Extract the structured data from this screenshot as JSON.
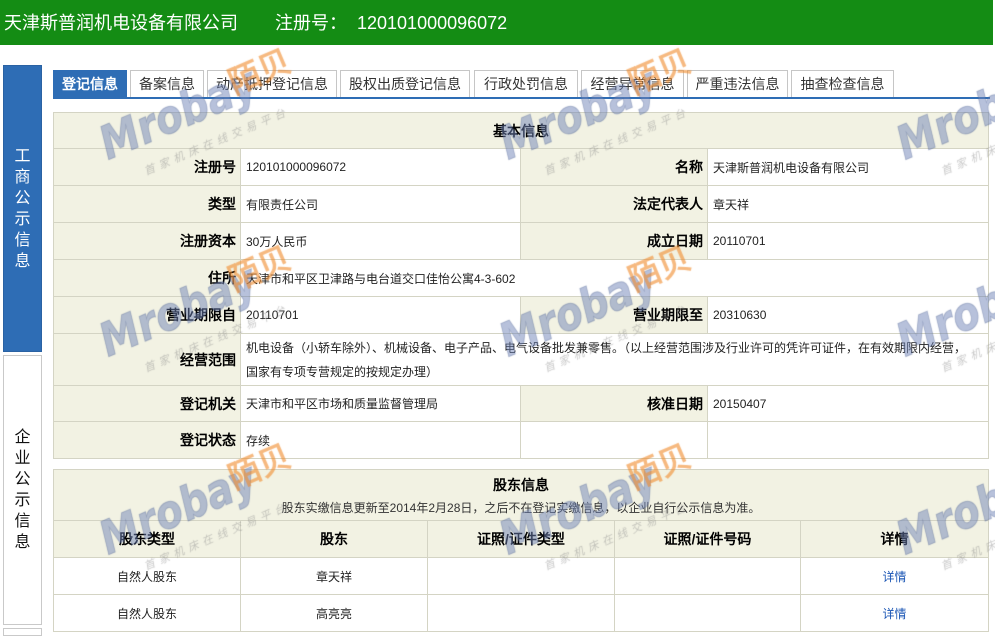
{
  "header": {
    "company_name": "天津斯普润机电设备有限公司",
    "reg_label": "注册号：",
    "reg_number": "120101000096072"
  },
  "sidebar": {
    "items": [
      {
        "label": "工商公示信息",
        "active": true
      },
      {
        "label": "企业公示信息",
        "active": false
      }
    ]
  },
  "tabs": [
    {
      "label": "登记信息",
      "active": true
    },
    {
      "label": "备案信息",
      "active": false
    },
    {
      "label": "动产抵押登记信息",
      "active": false
    },
    {
      "label": "股权出质登记信息",
      "active": false
    },
    {
      "label": "行政处罚信息",
      "active": false
    },
    {
      "label": "经营异常信息",
      "active": false
    },
    {
      "label": "严重违法信息",
      "active": false
    },
    {
      "label": "抽查检查信息",
      "active": false
    }
  ],
  "basic_info": {
    "title": "基本信息",
    "reg_no": {
      "label": "注册号",
      "value": "120101000096072"
    },
    "name": {
      "label": "名称",
      "value": "天津斯普润机电设备有限公司"
    },
    "type": {
      "label": "类型",
      "value": "有限责任公司"
    },
    "legal_rep": {
      "label": "法定代表人",
      "value": "章天祥"
    },
    "reg_capital": {
      "label": "注册资本",
      "value": "30万人民币"
    },
    "established": {
      "label": "成立日期",
      "value": "20110701"
    },
    "address": {
      "label": "住所",
      "value": "天津市和平区卫津路与电台道交口佳怡公寓4-3-602"
    },
    "term_from": {
      "label": "营业期限自",
      "value": "20110701"
    },
    "term_to": {
      "label": "营业期限至",
      "value": "20310630"
    },
    "scope": {
      "label": "经营范围",
      "value": "机电设备（小轿车除外）、机械设备、电子产品、电气设备批发兼零售。（以上经营范围涉及行业许可的凭许可证件，在有效期限内经营，国家有专项专营规定的按规定办理）"
    },
    "authority": {
      "label": "登记机关",
      "value": "天津市和平区市场和质量监督管理局"
    },
    "approval_date": {
      "label": "核准日期",
      "value": "20150407"
    },
    "status": {
      "label": "登记状态",
      "value": "存续"
    }
  },
  "shareholders": {
    "title": "股东信息",
    "note": "股东实缴信息更新至2014年2月28日，之后不在登记实缴信息，以企业自行公示信息为准。",
    "columns": [
      "股东类型",
      "股东",
      "证照/证件类型",
      "证照/证件号码",
      "详情"
    ],
    "rows": [
      {
        "type": "自然人股东",
        "name": "章天祥",
        "detail": "详情"
      },
      {
        "type": "自然人股东",
        "name": "高亮亮",
        "detail": "详情"
      }
    ]
  },
  "watermark": {
    "brand": "Mrobay",
    "brand_cn": "陌贝",
    "tagline": "首家机床在线交易平台"
  },
  "colors": {
    "header_green": "#148c14",
    "accent_blue": "#2e6db5",
    "label_bg": "#f2f2e3",
    "link_blue": "#1b56b5",
    "watermark_blue": "#6f84b8",
    "watermark_orange": "#f08a2c",
    "watermark_grey": "#8a8a8a"
  }
}
